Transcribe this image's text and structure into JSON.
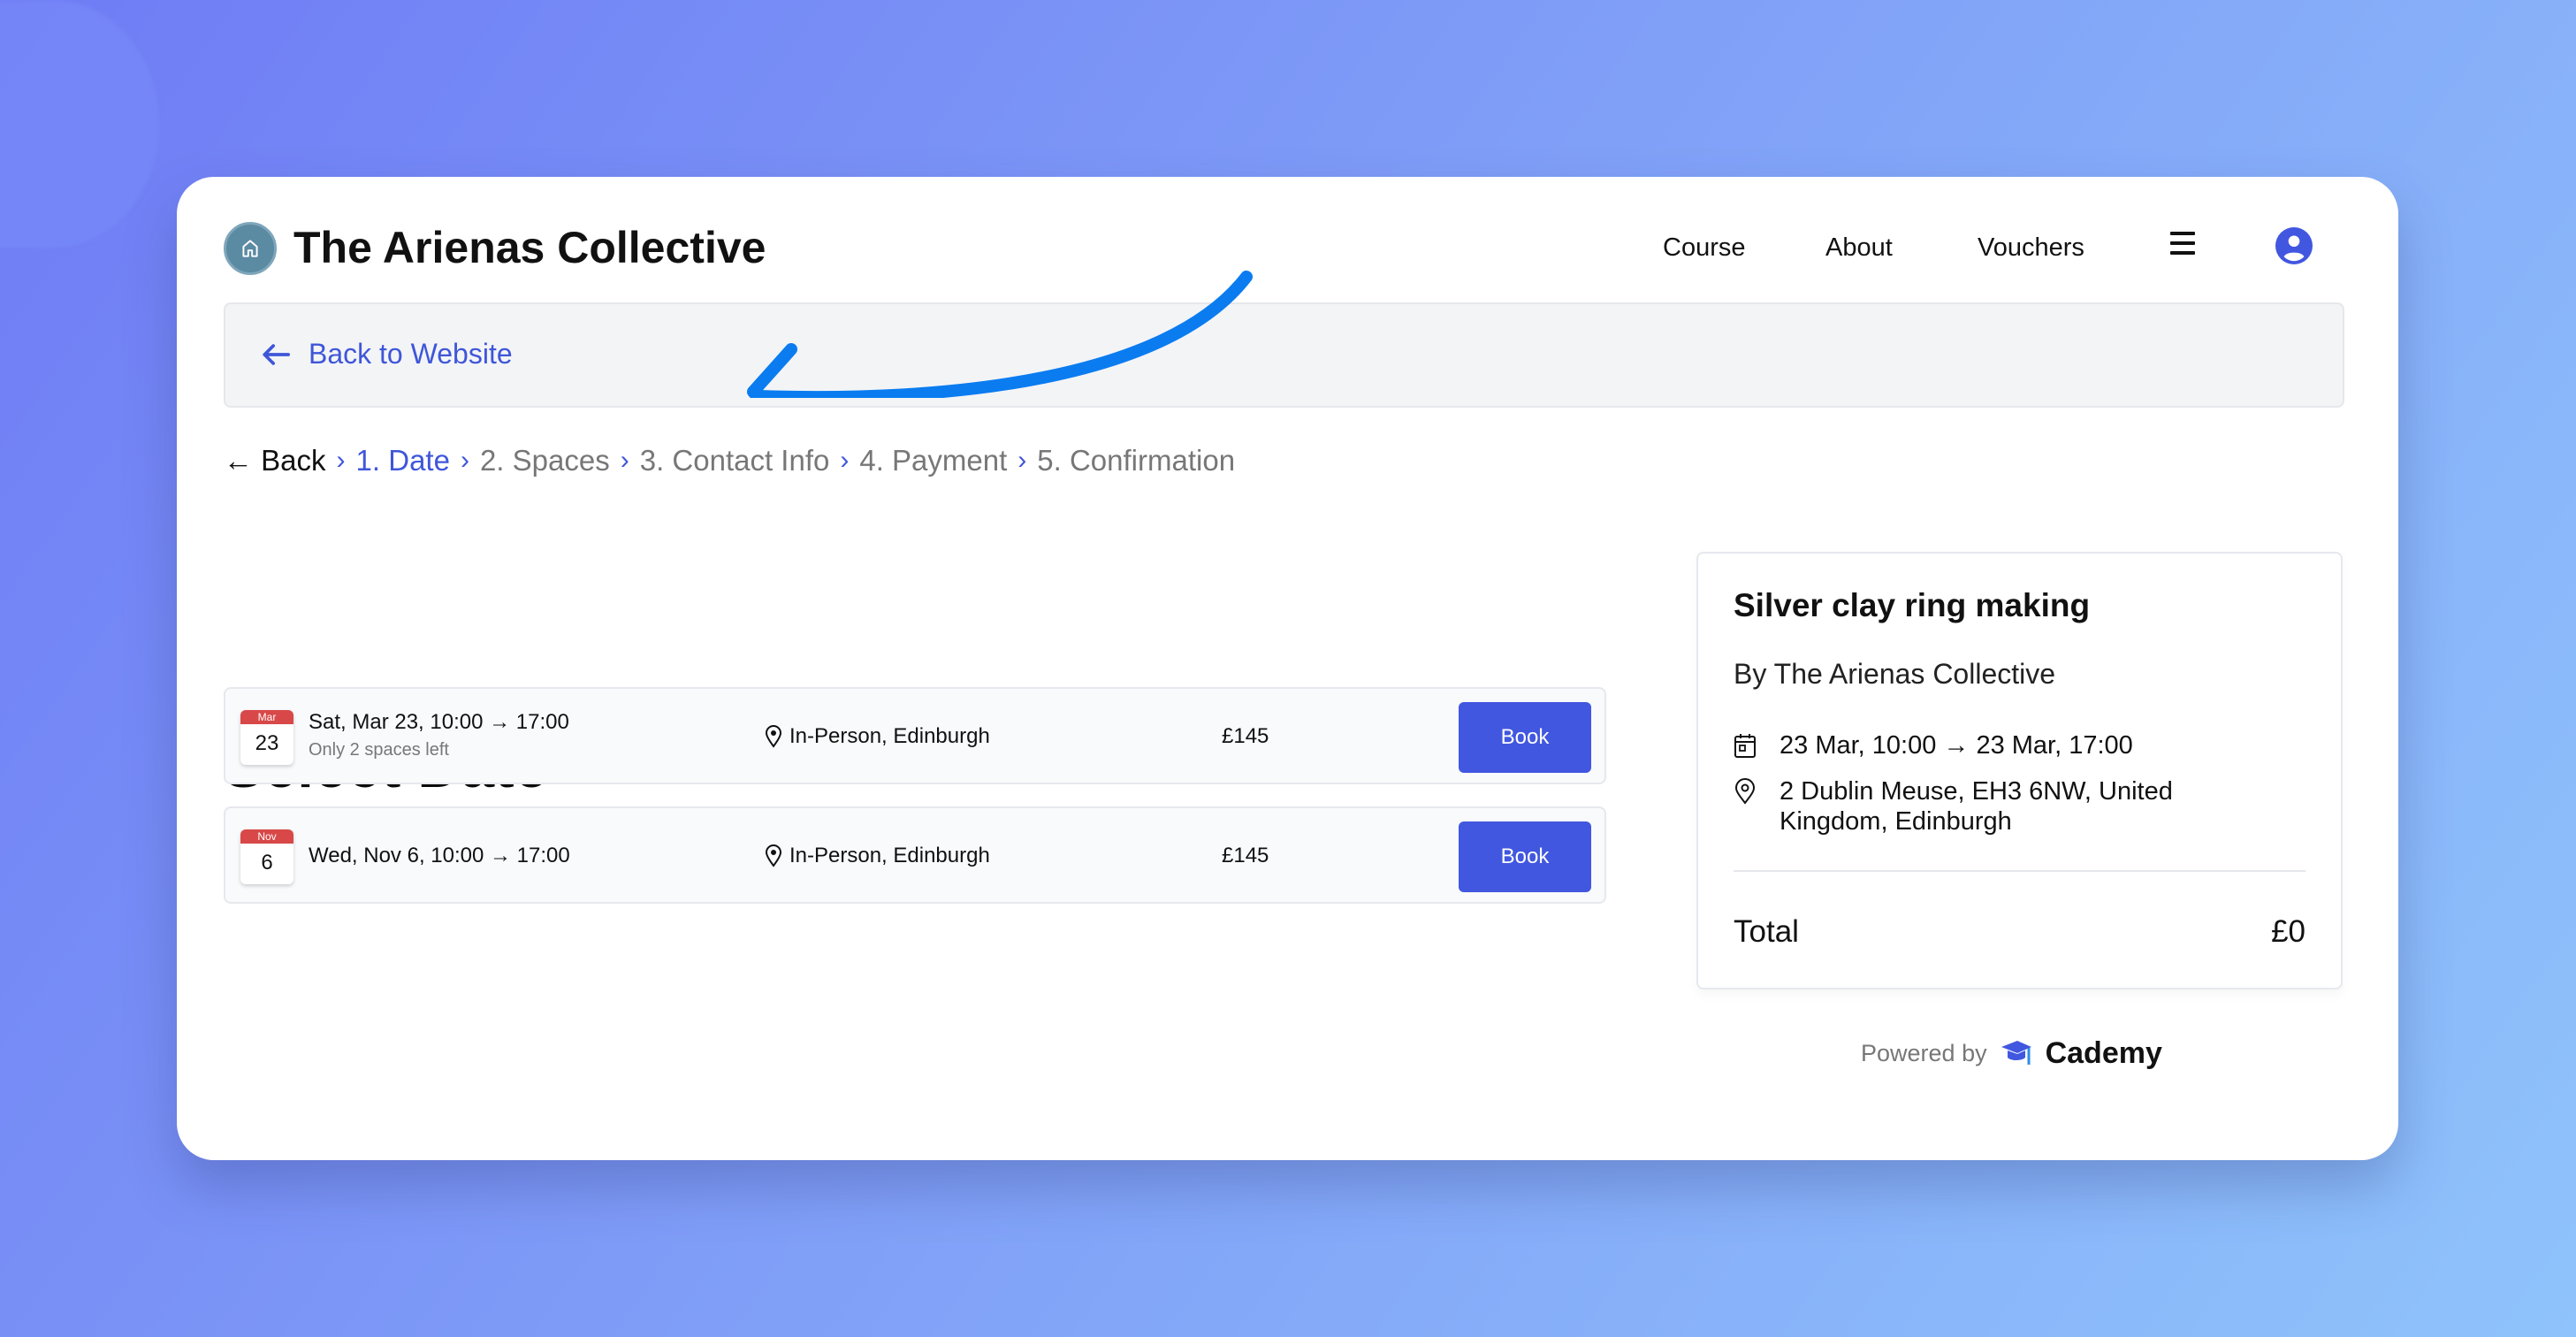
{
  "header": {
    "brand": "The Arienas Collective",
    "nav": [
      {
        "label": "Course"
      },
      {
        "label": "About"
      },
      {
        "label": "Vouchers"
      }
    ],
    "menu_icon": "hamburger-icon",
    "user_icon": "user-circle-icon"
  },
  "banner": {
    "back_label": "Back to Website",
    "icon": "arrow-left-icon"
  },
  "breadcrumb": {
    "back": "← Back",
    "separator": "›",
    "steps": [
      {
        "label": "1. Date",
        "active": true
      },
      {
        "label": "2. Spaces",
        "active": false
      },
      {
        "label": "3. Contact Info",
        "active": false
      },
      {
        "label": "4. Payment",
        "active": false
      },
      {
        "label": "5. Confirmation",
        "active": false
      }
    ]
  },
  "main": {
    "title": "Select Date",
    "sessions": [
      {
        "month": "Mar",
        "day": "23",
        "when": "Sat, Mar 23, 10:00 → 17:00",
        "availability": "Only 2 spaces left",
        "location": "In-Person, Edinburgh",
        "price": "£145",
        "button": "Book"
      },
      {
        "month": "Nov",
        "day": "6",
        "when": "Wed, Nov 6, 10:00 → 17:00",
        "availability": "",
        "location": "In-Person, Edinburgh",
        "price": "£145",
        "button": "Book"
      }
    ]
  },
  "summary": {
    "course": "Silver clay ring making",
    "by": "By The Arienas Collective",
    "datetime": "23 Mar, 10:00 → 23 Mar, 17:00",
    "address": "2 Dublin Meuse, EH3 6NW, United Kingdom, Edinburgh",
    "total_label": "Total",
    "total_value": "£0"
  },
  "footer": {
    "powered_by": "Powered by",
    "brand": "Cademy"
  },
  "colors": {
    "accent": "#4157e0",
    "link": "#3f56d9",
    "calendar_red": "#d84848",
    "annotation_arrow": "#0a7cf0"
  }
}
